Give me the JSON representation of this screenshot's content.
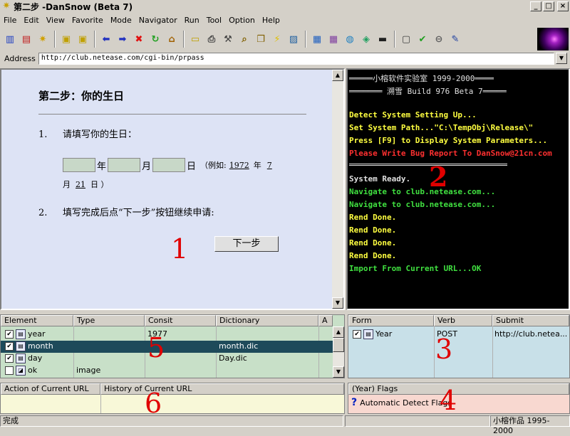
{
  "window": {
    "title": "第二步 -DanSnow (Beta 7)",
    "buttons": [
      "_",
      "□",
      "×"
    ]
  },
  "menu": [
    "File",
    "Edit",
    "View",
    "Favorite",
    "Mode",
    "Navigator",
    "Run",
    "Tool",
    "Option",
    "Help"
  ],
  "address": {
    "label": "Address",
    "value": "http://club.netease.com/cgi-bin/prpass"
  },
  "browser": {
    "step_title": "第二步：你的生日",
    "q1_num": "1.",
    "q1_text": "请填写你的生日：",
    "year_char": "年",
    "month_char": "月",
    "day_char": "日",
    "example_prefix": "（例如:",
    "example_year": "1972",
    "example_year_char": "年",
    "example_month": "7",
    "example_month_char": "月",
    "example_day": "21",
    "example_suffix": "日 ）",
    "q2_num": "2.",
    "q2_text": "填写完成后点“下一步”按钮继续申请:",
    "next_label": "下一步"
  },
  "console": {
    "header1": "═════小榕软件实验室 1999-2000════",
    "header2": "═══════ 溯雪 Build 976 Beta 7═════",
    "line1": "Detect System Setting Up...",
    "line2": "Set System Path...\"C:\\TempObj\\Release\\\"",
    "line3": "Press [F9] to Display System Parameters...",
    "line4": "Please Write Bug Report To DanSnow@21cn.com",
    "line5": "System Ready.",
    "line6": "Navigate to club.netease.com...",
    "line7": "Navigate to club.netease.com...",
    "line8": "Rend Done.",
    "line9": "Rend Done.",
    "line10": "Rend Done.",
    "line11": "Rend Done.",
    "line12": "Import From Current URL...OK"
  },
  "elements_table": {
    "headers": [
      "Element",
      "Type",
      "Consit",
      "Dictionary",
      "A"
    ],
    "rows": [
      {
        "name": "year",
        "type": "",
        "consit": "1977",
        "dictionary": "",
        "checked": true
      },
      {
        "name": "month",
        "type": "",
        "consit": "",
        "dictionary": "month.dic",
        "checked": true
      },
      {
        "name": "day",
        "type": "",
        "consit": "",
        "dictionary": "Day.dic",
        "checked": true
      },
      {
        "name": "ok",
        "type": "image",
        "consit": "",
        "dictionary": "",
        "checked": false
      }
    ]
  },
  "forms_table": {
    "headers": [
      "Form",
      "Verb",
      "Submit"
    ],
    "rows": [
      {
        "form": "Year",
        "verb": "POST",
        "submit": "http://club.netea..."
      }
    ]
  },
  "actions": {
    "col1": "Action of Current URL",
    "col2": "History of Current URL"
  },
  "flags": {
    "title": "(Year) Flags",
    "item": "Automatic Detect Flags"
  },
  "markers": [
    "1",
    "2",
    "3",
    "4",
    "5",
    "6"
  ],
  "status": {
    "left": "完成",
    "right": "小榕作品 1995-2000"
  },
  "colors": {
    "console_bg": "#000000",
    "green": "#00e000",
    "yellow": "#ffff40",
    "red": "#ff3030",
    "marker_red": "#e00000"
  }
}
